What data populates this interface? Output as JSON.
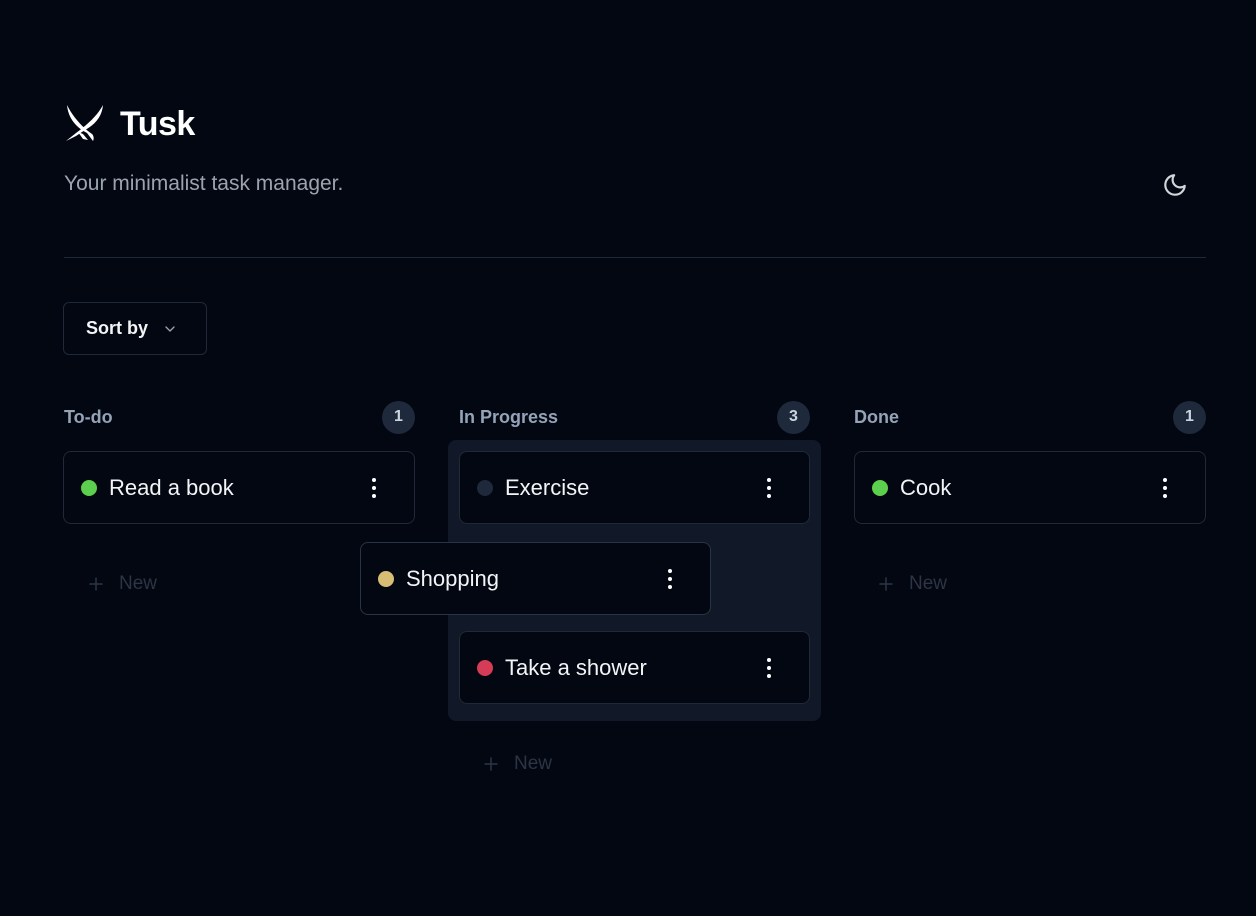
{
  "app": {
    "title": "Tusk",
    "tagline": "Your minimalist task manager.",
    "logo_icon": "tusk-logo-icon",
    "theme_icon": "moon-icon"
  },
  "toolbar": {
    "sort_label": "Sort by",
    "sort_icon": "chevron-down-icon"
  },
  "columns": [
    {
      "title": "To-do",
      "count": "1",
      "new_label": "New",
      "tasks": [
        {
          "label": "Read a book",
          "status_color": "#5ccf4e"
        }
      ]
    },
    {
      "title": "In Progress",
      "count": "3",
      "new_label": "New",
      "tasks": [
        {
          "label": "Exercise",
          "status_color": "#1e293b"
        },
        {
          "label": "Take a shower",
          "status_color": "#d63c55"
        }
      ]
    },
    {
      "title": "Done",
      "count": "1",
      "new_label": "New",
      "tasks": [
        {
          "label": "Cook",
          "status_color": "#5ccf4e"
        }
      ]
    }
  ],
  "dragging_task": {
    "label": "Shopping",
    "status_color": "#d8bd74"
  },
  "colors": {
    "background": "#030712",
    "border": "#1f2937",
    "drop_zone": "#111827",
    "muted_text": "#9ca3af",
    "badge_bg": "#1e293b"
  }
}
